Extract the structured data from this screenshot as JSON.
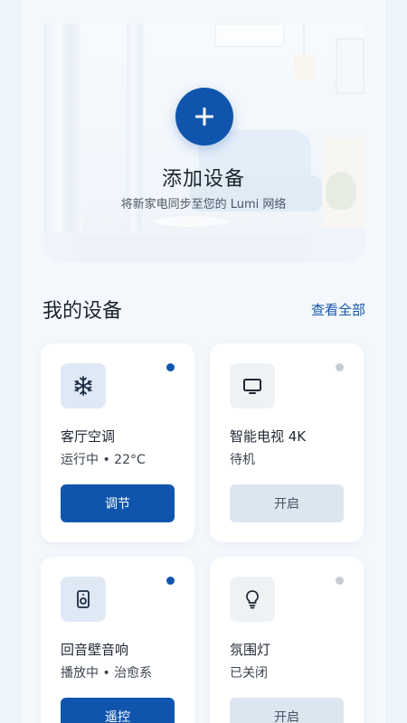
{
  "hero": {
    "title": "添加设备",
    "subtitle": "将新家电同步至您的 Lumi 网络",
    "add_icon": "plus-icon"
  },
  "devices_section": {
    "title": "我的设备",
    "see_all": "查看全部"
  },
  "devices": [
    {
      "name": "客厅空调",
      "status": "运行中 • 22°C",
      "action": "调节",
      "icon": "snowflake-icon",
      "online": true
    },
    {
      "name": "智能电视 4K",
      "status": "待机",
      "action": "开启",
      "icon": "tv-icon",
      "online": false
    },
    {
      "name": "回音壁音响",
      "status": "播放中 • 治愈系",
      "action": "遥控",
      "icon": "speaker-icon",
      "online": true
    },
    {
      "name": "氛围灯",
      "status": "已关闭",
      "action": "开启",
      "icon": "lightbulb-icon",
      "online": false
    }
  ],
  "colors": {
    "accent": "#1055ad",
    "background": "#f4f8fc",
    "card": "#ffffff",
    "inactive_button": "#dbe6f1"
  }
}
